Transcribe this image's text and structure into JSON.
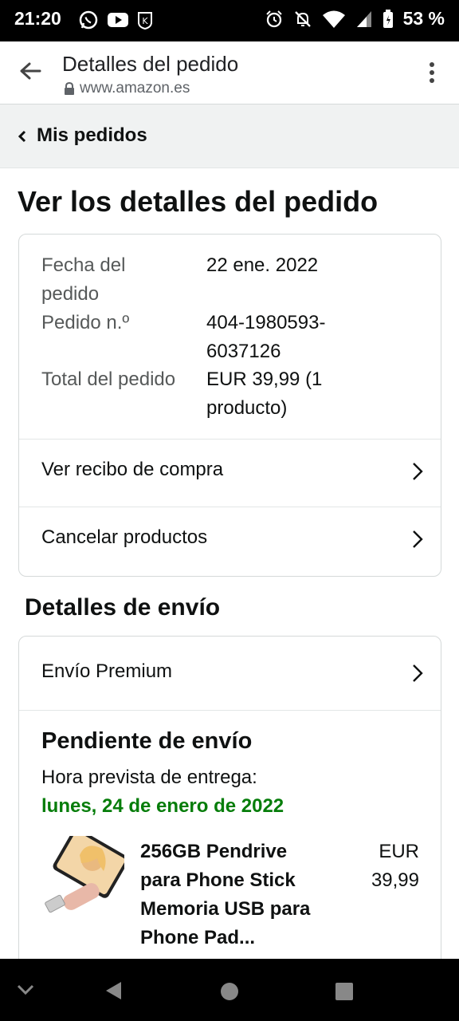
{
  "status_bar": {
    "time": "21:20",
    "battery": "53 %",
    "left_icons": [
      "whatsapp-icon",
      "youtube-icon",
      "shield-icon"
    ],
    "right_icons": [
      "alarm-icon",
      "mute-icon",
      "wifi-icon",
      "signal-icon",
      "battery-icon"
    ]
  },
  "browser": {
    "title": "Detalles del pedido",
    "url": "www.amazon.es"
  },
  "breadcrumb": {
    "label": "Mis pedidos"
  },
  "page": {
    "title": "Ver los detalles del pedido"
  },
  "order_summary": {
    "date_label": "Fecha del pedido",
    "date_value": "22 ene. 2022",
    "number_label": "Pedido n.º",
    "number_value": "404-1980593-6037126",
    "total_label": "Total del pedido",
    "total_value": "EUR 39,99 (1 producto)"
  },
  "actions": {
    "receipt": "Ver recibo de compra",
    "cancel": "Cancelar productos"
  },
  "shipping": {
    "section_title": "Detalles de envío",
    "method": "Envío Premium",
    "status": "Pendiente de envío",
    "eta_label": "Hora prevista de entrega:",
    "eta_date": "lunes, 24 de enero de 2022",
    "eta_color": "#067d0a"
  },
  "product": {
    "title": "256GB Pendrive para Phone Stick Memoria USB para Phone Pad...",
    "price": "EUR 39,99"
  }
}
